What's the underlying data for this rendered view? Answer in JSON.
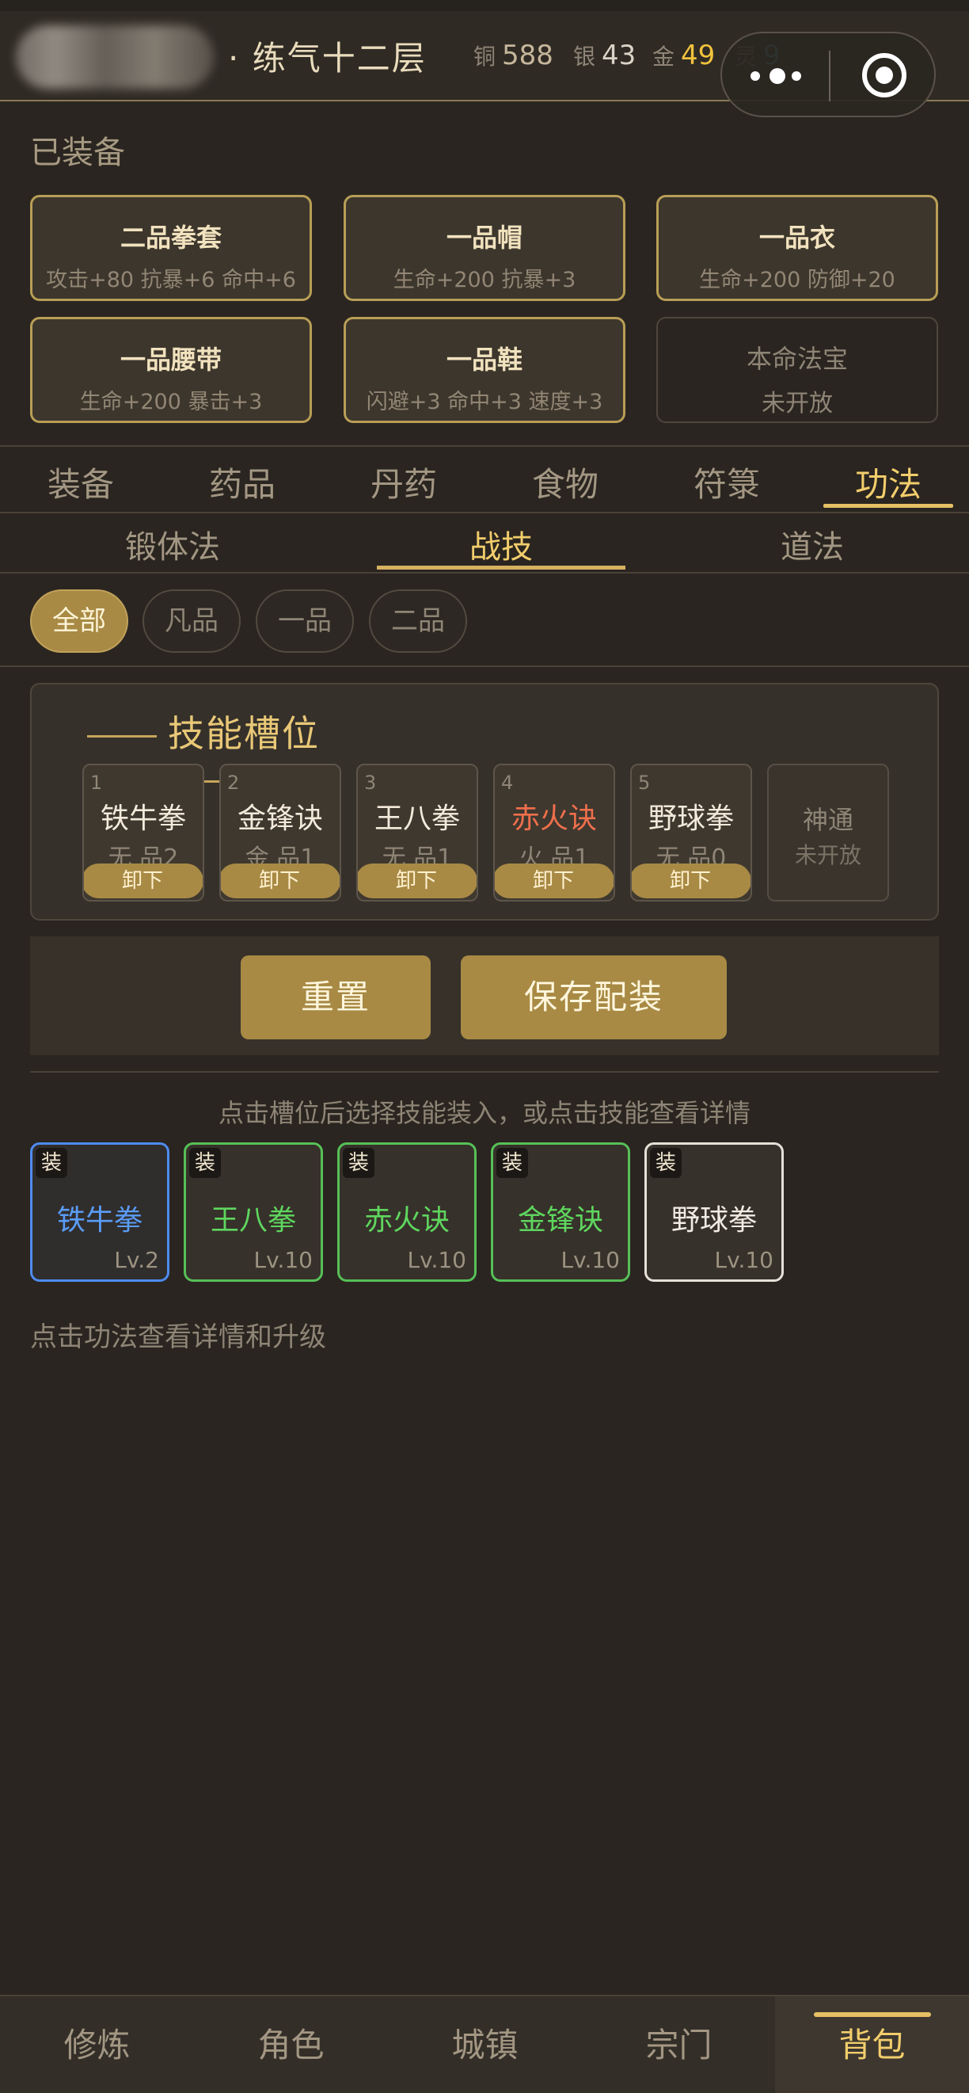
{
  "header": {
    "char_name": "· 练气十二层",
    "currencies": [
      {
        "label": "铜",
        "value": "588"
      },
      {
        "label": "银",
        "value": "43"
      },
      {
        "label": "金",
        "value": "49"
      },
      {
        "label": "灵",
        "value": "9"
      }
    ]
  },
  "equipped": {
    "title": "已装备",
    "items": [
      {
        "name": "二品拳套",
        "stats": "攻击+80 抗暴+6 命中+6"
      },
      {
        "name": "一品帽",
        "stats": "生命+200 抗暴+3"
      },
      {
        "name": "一品衣",
        "stats": "生命+200 防御+20"
      },
      {
        "name": "一品腰带",
        "stats": "生命+200 暴击+3"
      },
      {
        "name": "一品鞋",
        "stats": "闪避+3 命中+3 速度+3"
      },
      {
        "name": "本命法宝",
        "stats": "未开放"
      }
    ]
  },
  "main_tabs": [
    "装备",
    "药品",
    "丹药",
    "食物",
    "符箓",
    "功法"
  ],
  "main_tab_active": "功法",
  "sub_tabs": [
    "锻体法",
    "战技",
    "道法"
  ],
  "sub_tab_active": "战技",
  "filters": [
    "全部",
    "凡品",
    "一品",
    "二品"
  ],
  "filter_active": "全部",
  "slots_panel": {
    "title": "技能槽位",
    "unequip_label": "卸下",
    "slots": [
      {
        "num": "1",
        "name": "铁牛拳",
        "grade": "无 品2"
      },
      {
        "num": "2",
        "name": "金锋诀",
        "grade": "金 品1"
      },
      {
        "num": "3",
        "name": "王八拳",
        "grade": "无 品1"
      },
      {
        "num": "4",
        "name": "赤火诀",
        "grade": "火 品1"
      },
      {
        "num": "5",
        "name": "野球拳",
        "grade": "无 品0"
      }
    ],
    "locked_slot": {
      "name": "神通",
      "status": "未开放"
    }
  },
  "actions": {
    "reset": "重置",
    "save": "保存配装"
  },
  "hint": "点击槽位后选择技能装入，或点击技能查看详情",
  "skills": [
    {
      "badge": "装",
      "name": "铁牛拳",
      "level": "Lv.2",
      "color": "#4e8cf0"
    },
    {
      "badge": "装",
      "name": "王八拳",
      "level": "Lv.10",
      "color": "#57c057"
    },
    {
      "badge": "装",
      "name": "赤火诀",
      "level": "Lv.10",
      "color": "#57c057"
    },
    {
      "badge": "装",
      "name": "金锋诀",
      "level": "Lv.10",
      "color": "#57c057"
    },
    {
      "badge": "装",
      "name": "野球拳",
      "level": "Lv.10",
      "color": "#e6e1d8"
    }
  ],
  "footnote": "点击功法查看详情和升级",
  "bottom_nav": [
    "修炼",
    "角色",
    "城镇",
    "宗门",
    "背包"
  ],
  "bottom_nav_active": "背包"
}
